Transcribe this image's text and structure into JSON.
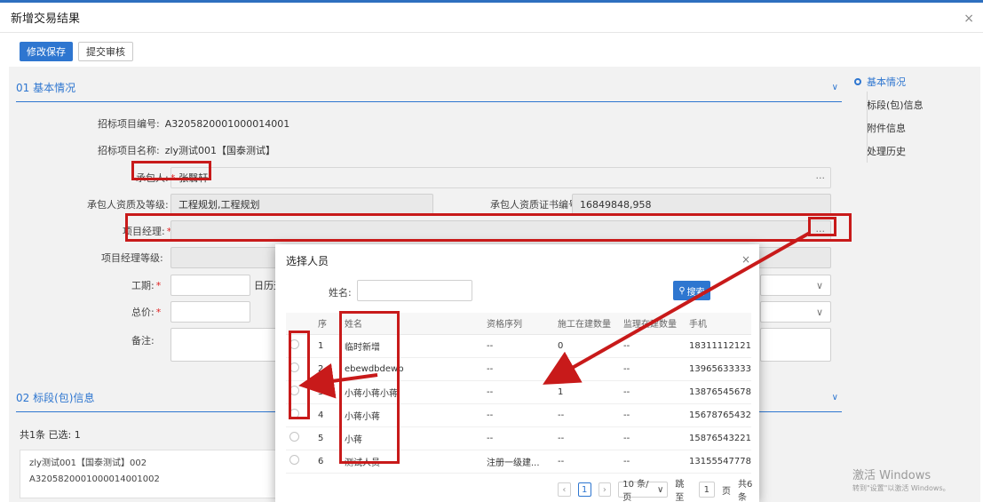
{
  "window": {
    "title": "新增交易结果",
    "close_glyph": "×"
  },
  "toolbar": {
    "save_label": "修改保存",
    "submit_label": "提交审核"
  },
  "section1": {
    "title": "01  基本情况"
  },
  "form": {
    "project_no_label": "招标项目编号:",
    "project_no": "A3205820001000014001",
    "project_name_label": "招标项目名称:",
    "project_name": "zly测试001【国泰测试】",
    "contractor_label": "承包人:",
    "contractor_value": "张翳轩",
    "qual_label": "承包人资质及等级:",
    "qual_value": "工程规划,工程规划",
    "cert_label": "承包人资质证书编号:",
    "cert_value": "16849848,958",
    "pm_label": "项目经理:",
    "pm_level_label": "项目经理等级:",
    "duration_label": "工期:",
    "duration_unit": "日历天",
    "price_label": "总价:",
    "remark_label": "备注:",
    "required_mark": "*",
    "picker_glyph": "···"
  },
  "section2": {
    "title": "02  标段(包)信息",
    "summary": "共1条  已选: 1",
    "lot_name": "zly测试001【国泰测试】002",
    "lot_code": "A3205820001000014001002"
  },
  "side_nav": {
    "items": [
      "基本情况",
      "标段(包)信息",
      "附件信息",
      "处理历史"
    ]
  },
  "modal": {
    "title": "选择人员",
    "close_glyph": "×",
    "search_label": "姓名:",
    "search_placeholder": "",
    "search_button": "搜索",
    "columns": [
      "序",
      "姓名",
      "资格序列",
      "施工在建数量",
      "监理在建数量",
      "手机"
    ],
    "rows": [
      {
        "no": "1",
        "name": "临时新增",
        "qual": "--",
        "build": "0",
        "supervise": "--",
        "phone": "18311112121"
      },
      {
        "no": "2",
        "name": "ebewdbdewb",
        "qual": "--",
        "build": "",
        "supervise": "--",
        "phone": "13965633333"
      },
      {
        "no": "3",
        "name": "小蒋小蒋小蒋",
        "qual": "--",
        "build": "1",
        "supervise": "--",
        "phone": "13876545678"
      },
      {
        "no": "4",
        "name": "小蒋小蒋",
        "qual": "--",
        "build": "--",
        "supervise": "--",
        "phone": "15678765432"
      },
      {
        "no": "5",
        "name": "小蒋",
        "qual": "--",
        "build": "--",
        "supervise": "--",
        "phone": "15876543221"
      },
      {
        "no": "6",
        "name": "测试人员",
        "qual": "注册一级建...",
        "build": "--",
        "supervise": "--",
        "phone": "13155547778"
      }
    ],
    "pager": {
      "prev": "‹",
      "current": "1",
      "next": "›",
      "page_size": "10  条/页",
      "jump_label": "跳至",
      "jump_value": "1",
      "page_suffix": "页",
      "total": "共6条"
    }
  },
  "os_watermark": {
    "line1": "激活 Windows",
    "line2": "转到\"设置\"以激活 Windows。"
  },
  "colors": {
    "accent": "#2e76d0",
    "annotation": "#c81a1a",
    "required": "#e02020"
  }
}
